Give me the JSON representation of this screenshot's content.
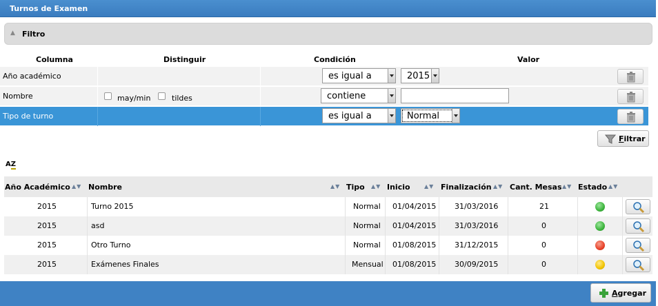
{
  "window": {
    "title": "Turnos de Examen"
  },
  "filtro": {
    "title": "Filtro",
    "headers": {
      "columna": "Columna",
      "distinguir": "Distinguir",
      "condicion": "Condición",
      "valor": "Valor"
    },
    "rows": [
      {
        "name": "Año académico",
        "condition": "es igual a",
        "value": "2015"
      },
      {
        "name": "Nombre",
        "condition": "contiene",
        "value": "",
        "opt_case": "may/min",
        "opt_accents": "tildes"
      },
      {
        "name": "Tipo de turno",
        "condition": "es igual a",
        "value": "Normal"
      }
    ],
    "filtrar_label_u": "F",
    "filtrar_label_rest": "iltrar"
  },
  "list": {
    "sort_icon": "A Z",
    "headers": {
      "anio": "Año Académico",
      "nombre": "Nombre",
      "tipo": "Tipo",
      "inicio": "Inicio",
      "fin": "Finalización",
      "cant": "Cant. Mesas",
      "estado": "Estado"
    },
    "rows": [
      {
        "anio": "2015",
        "nombre": "Turno 2015",
        "tipo": "Normal",
        "inicio": "01/04/2015",
        "fin": "31/03/2016",
        "cant": "21",
        "estado": "green"
      },
      {
        "anio": "2015",
        "nombre": "asd",
        "tipo": "Normal",
        "inicio": "01/04/2015",
        "fin": "31/03/2016",
        "cant": "0",
        "estado": "green"
      },
      {
        "anio": "2015",
        "nombre": "Otro Turno",
        "tipo": "Normal",
        "inicio": "01/08/2015",
        "fin": "31/12/2015",
        "cant": "0",
        "estado": "red"
      },
      {
        "anio": "2015",
        "nombre": "Exámenes Finales",
        "tipo": "Mensual",
        "inicio": "01/08/2015",
        "fin": "30/09/2015",
        "cant": "0",
        "estado": "yellow"
      }
    ]
  },
  "footer": {
    "agregar_u": "A",
    "agregar_rest": "gregar"
  },
  "colors": {
    "titlebar": "#3a7cbf",
    "selected_row": "#3a95d7",
    "green": "#3db43d",
    "red": "#e8432a",
    "yellow": "#f2c400"
  }
}
